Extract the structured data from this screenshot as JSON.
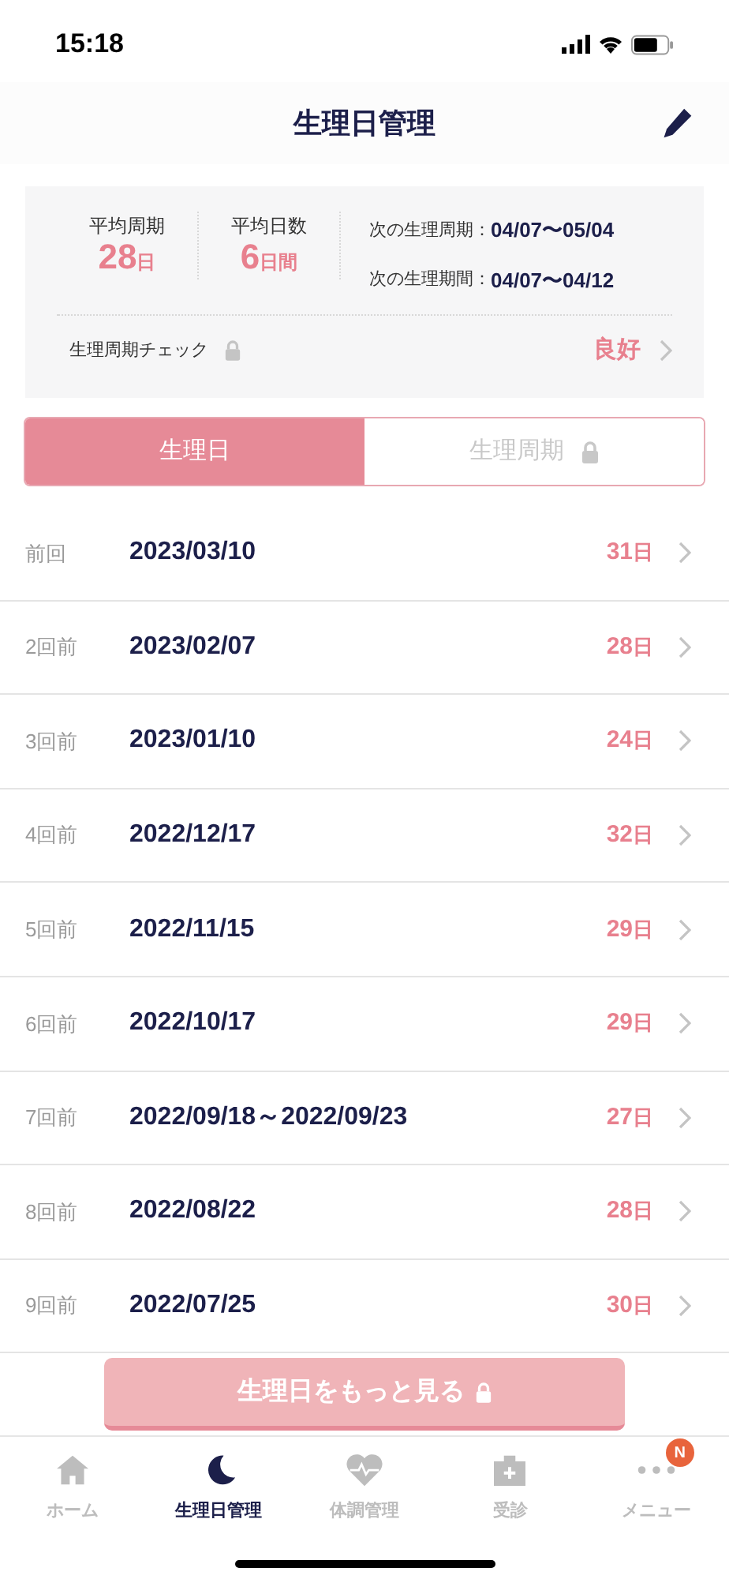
{
  "status_bar": {
    "time": "15:18"
  },
  "header": {
    "title": "生理日管理"
  },
  "summary": {
    "stats": [
      {
        "label": "平均周期",
        "value": "28",
        "unit": "日"
      },
      {
        "label": "平均日数",
        "value": "6",
        "unit": "日間"
      }
    ],
    "next": [
      {
        "label": "次の生理周期：",
        "value": "04/07〜05/04"
      },
      {
        "label": "次の生理期間：",
        "value": "04/07〜04/12"
      }
    ],
    "check": {
      "label": "生理周期チェック",
      "locked": true,
      "result": "良好"
    }
  },
  "tabs": [
    {
      "label": "生理日",
      "selected": true,
      "locked": false
    },
    {
      "label": "生理周期",
      "selected": false,
      "locked": true
    }
  ],
  "records": [
    {
      "label": "前回",
      "date": "2023/03/10",
      "days": "31",
      "unit": "日"
    },
    {
      "label": "2回前",
      "date": "2023/02/07",
      "days": "28",
      "unit": "日"
    },
    {
      "label": "3回前",
      "date": "2023/01/10",
      "days": "24",
      "unit": "日"
    },
    {
      "label": "4回前",
      "date": "2022/12/17",
      "days": "32",
      "unit": "日"
    },
    {
      "label": "5回前",
      "date": "2022/11/15",
      "days": "29",
      "unit": "日"
    },
    {
      "label": "6回前",
      "date": "2022/10/17",
      "days": "29",
      "unit": "日"
    },
    {
      "label": "7回前",
      "date": "2022/09/18～2022/09/23",
      "days": "27",
      "unit": "日"
    },
    {
      "label": "8回前",
      "date": "2022/08/22",
      "days": "28",
      "unit": "日"
    },
    {
      "label": "9回前",
      "date": "2022/07/25",
      "days": "30",
      "unit": "日"
    }
  ],
  "more_button": {
    "label": "生理日をもっと見る",
    "locked": true
  },
  "tab_bar": [
    {
      "kind": "home",
      "label": "ホーム",
      "selected": false
    },
    {
      "kind": "moon",
      "label": "生理日管理",
      "selected": true
    },
    {
      "kind": "heart",
      "label": "体調管理",
      "selected": false
    },
    {
      "kind": "clinic",
      "label": "受診",
      "selected": false
    },
    {
      "kind": "menu",
      "label": "メニュー",
      "selected": false,
      "badge": "N"
    }
  ]
}
